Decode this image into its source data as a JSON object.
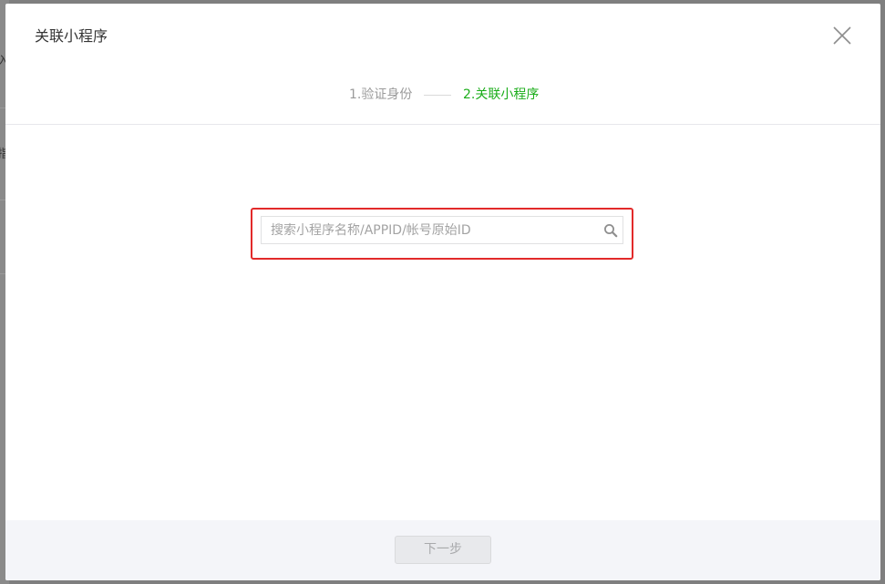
{
  "dialog": {
    "title": "关联小程序",
    "close_icon": "close-icon"
  },
  "steps": [
    {
      "label": "1.验证身份",
      "state": "done"
    },
    {
      "label": "2.关联小程序",
      "state": "active"
    }
  ],
  "search": {
    "placeholder": "搜索小程序名称/APPID/帐号原始ID",
    "value": "",
    "icon": "search-icon"
  },
  "footer": {
    "next_label": "下一步",
    "next_enabled": false
  },
  "colors": {
    "active_step": "#1aad19",
    "inactive_step": "#9a9a9a",
    "highlight_border": "#e22a2a",
    "overlay": "#7f7f7f"
  },
  "underlay": {
    "chars": [
      "入",
      "指"
    ]
  }
}
